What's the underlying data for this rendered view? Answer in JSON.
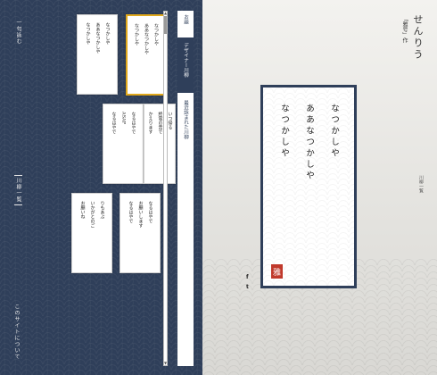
{
  "sidebar": {
    "compose_label": "一句詠む",
    "list_label": "川柳一覧",
    "about_label": "このサイトについて"
  },
  "cards": [
    {
      "lines": [
        "なつかしや",
        "ああなつかしや",
        "なつかしや"
      ],
      "selected": false
    },
    {
      "lines": [
        "なつかしや",
        "ああなつかしや",
        "なつかしや"
      ],
      "selected": true
    },
    {
      "lines": [
        "なるはやで",
        "ASAP",
        "なるはやで"
      ],
      "selected": false
    },
    {
      "lines": [
        "いつ帰る",
        "終電の音で",
        "かえります"
      ],
      "selected": false
    },
    {
      "lines": [
        "りもあぶ",
        "いかがとのご",
        "お願いね"
      ],
      "selected": false
    },
    {
      "lines": [
        "なるはやで",
        "お願いします",
        "なるはやで"
      ],
      "selected": false
    }
  ],
  "tabs": {
    "selected_label": "お題",
    "design_label": "デザイナー川柳",
    "recent_label": "最近詠まれた川柳"
  },
  "detail": {
    "app_title": "せんりう",
    "author": "「雅号」作",
    "list_link": "川柳一覧",
    "poem_lines": [
      "なつかしや",
      "ああなつかしや",
      "なつかしや"
    ],
    "seal": "雅",
    "facebook": "f",
    "twitter": "t"
  },
  "colors": {
    "navy": "#2f3f5a",
    "selected_border": "#e0a81c",
    "seal": "#c0392b"
  }
}
